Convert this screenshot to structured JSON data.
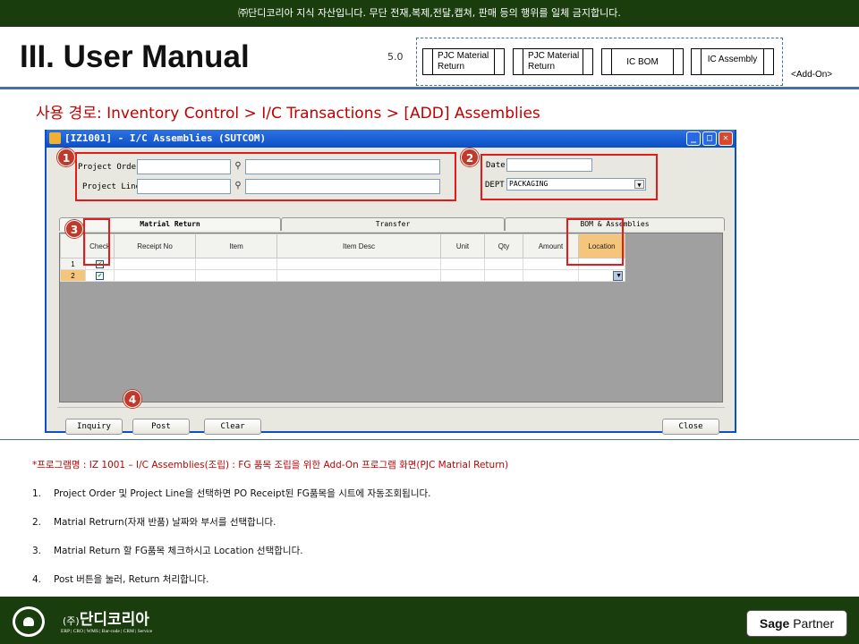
{
  "banner": "㈜단디코리아  지식 자산입니다. 무단 전재,복제,전달,캡쳐,  판매 등의 행위를 일체 금지합니다.",
  "header": {
    "title": "III. User Manual",
    "version": "5.0",
    "tabs": [
      {
        "label": "PJC Material Return"
      },
      {
        "label": "PJC Material Return"
      },
      {
        "label": "IC BOM"
      },
      {
        "label": "IC Assembly"
      }
    ],
    "addon": "<Add-On>"
  },
  "path": "사용 경로: Inventory Control > I/C Transactions > [ADD] Assemblies",
  "window": {
    "title": "[IZ1001] - I/C Assemblies (SUTCOM)",
    "project_order_label": "Project Order",
    "project_line_label": "Project Line",
    "date_label": "Date",
    "dept_label": "DEPT",
    "dept_value": "PACKAGING",
    "tabs": [
      "Matrial Return",
      "Transfer",
      "BOM & Assemblies"
    ],
    "columns": [
      "Check",
      "Receipt No",
      "Item",
      "Item Desc",
      "Unit",
      "Qty",
      "Amount",
      "Location"
    ],
    "rows": [
      {
        "num": "1",
        "checked": true
      },
      {
        "num": "2",
        "checked": true
      }
    ],
    "buttons": {
      "inquiry": "Inquiry",
      "post": "Post",
      "clear": "Clear",
      "close": "Close"
    }
  },
  "markers": [
    "1",
    "2",
    "3",
    "4"
  ],
  "note": "*프로그램명 : IZ 1001 – I/C Assemblies(조립) : FG 품목 조립을 위한 Add-On 프로그램 화면(PJC  Matrial Return)",
  "steps": [
    {
      "num": "1.",
      "text": "Project Order 및 Project Line을 선택하면 PO Receipt된 FG품목을 시트에 자동조회됩니다."
    },
    {
      "num": "2.",
      "text": "Matrial Retrurn(자재 반품) 날짜와 부서를 선택합니다."
    },
    {
      "num": "3.",
      "text": "Matrial Return 할 FG품목 체크하시고 Location 선택합니다."
    },
    {
      "num": "4.",
      "text": "Post 버튼을 눌러, Return 처리합니다."
    }
  ],
  "footer": {
    "company": "단디코리아",
    "company_prefix": "(주)",
    "tagline": "ERP | CRO | WMS | Bar-code | CRM | Service",
    "partner_brand": "Sage",
    "partner_word": "Partner"
  }
}
